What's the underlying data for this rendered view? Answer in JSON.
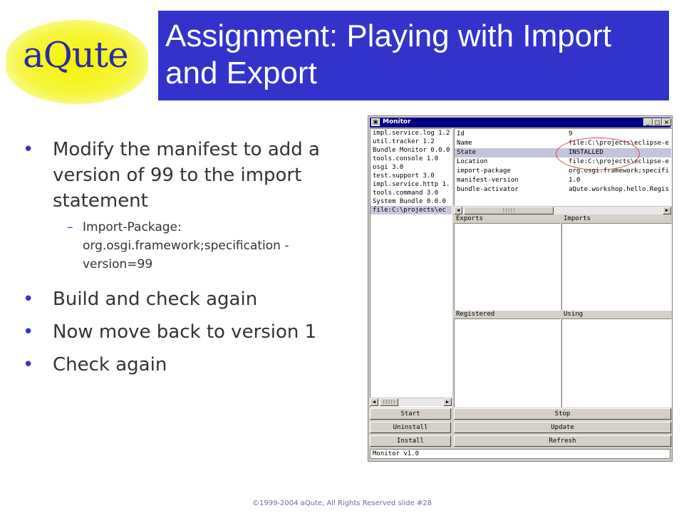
{
  "logo": {
    "text": "aQute"
  },
  "slide": {
    "title": "Assignment: Playing with Import and Export",
    "bullets": [
      {
        "text": "Modify the manifest to add a version of 99 to the import statement"
      },
      {
        "text": "Build and check again"
      },
      {
        "text": "Now move back to version 1"
      },
      {
        "text": "Check again"
      }
    ],
    "sub_bullet": "Import-Package: org.osgi.framework;specification -version=99",
    "footer": "©1999-2004 aQute, All Rights Reserved slide #28"
  },
  "monitor": {
    "title": "Monitor",
    "bundles": [
      "impl.service.log 1.2",
      "util.tracker 1.2",
      "Bundle Monitor 0.0.0",
      "tools.console 1.0",
      "osgi 3.0",
      "test.support 3.0",
      "impl.service.http 1.",
      "tools.command 3.0",
      "System Bundle 0.0.0",
      "file:C:\\projects\\ec"
    ],
    "properties": [
      {
        "key": "Id",
        "value": "9"
      },
      {
        "key": "Name",
        "value": "file:C:\\projects\\eclipse-e"
      },
      {
        "key": "State",
        "value": "INSTALLED"
      },
      {
        "key": "Location",
        "value": "file:C:\\projects\\eclipse-e"
      },
      {
        "key": "import-package",
        "value": "org.osgi.framework;specifi"
      },
      {
        "key": "manifest-version",
        "value": "1.0"
      },
      {
        "key": "bundle-activator",
        "value": "aQute.workshop.hello.Regis"
      }
    ],
    "panes": {
      "exports": "Exports",
      "imports": "Imports",
      "registered": "Registered",
      "using": "Using"
    },
    "buttons": {
      "start": "Start",
      "stop": "Stop",
      "uninstall": "Uninstall",
      "update": "Update",
      "install": "Install",
      "refresh": "Refresh"
    },
    "status": "Monitor v1.0"
  },
  "colors": {
    "title_bg": "#3333cc",
    "logo_yellow": "#f2f200",
    "highlight_ring": "#d04a3a"
  }
}
